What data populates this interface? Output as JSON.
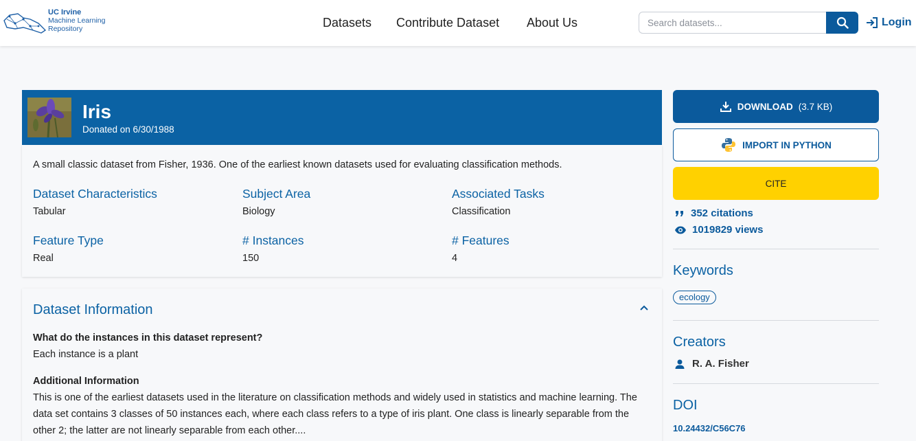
{
  "header": {
    "logo": {
      "line1": "UC Irvine",
      "line2": "Machine Learning",
      "line3": "Repository"
    },
    "nav": [
      {
        "label": "Datasets"
      },
      {
        "label": "Contribute Dataset"
      },
      {
        "label": "About Us"
      }
    ],
    "search": {
      "placeholder": "Search datasets...",
      "value": ""
    },
    "login_label": "Login"
  },
  "dataset": {
    "title": "Iris",
    "donated": "Donated on 6/30/1988",
    "description": "A small classic dataset from Fisher, 1936. One of the earliest known datasets used for evaluating classification methods.",
    "characteristics": [
      {
        "label": "Dataset Characteristics",
        "value": "Tabular"
      },
      {
        "label": "Subject Area",
        "value": "Biology"
      },
      {
        "label": "Associated Tasks",
        "value": "Classification"
      },
      {
        "label": "Feature Type",
        "value": "Real"
      },
      {
        "label": "# Instances",
        "value": "150"
      },
      {
        "label": "# Features",
        "value": "4"
      }
    ]
  },
  "info": {
    "title": "Dataset Information",
    "q1": "What do the instances in this dataset represent?",
    "a1": "Each instance is a plant",
    "q2": "Additional Information",
    "a2": "This is one of the earliest datasets used in the literature on classification methods and widely used in statistics and machine learning.  The data set contains 3 classes of 50 instances each, where each class refers to a type of iris plant.  One class is linearly separable from the other 2; the latter are not linearly separable from each other...."
  },
  "sidebar": {
    "download_label": "DOWNLOAD",
    "download_size": "(3.7 KB)",
    "python_label": "IMPORT IN PYTHON",
    "cite_label": "CITE",
    "citations": "352 citations",
    "views": "1019829 views",
    "keywords_title": "Keywords",
    "keywords": [
      "ecology"
    ],
    "creators_title": "Creators",
    "creators": [
      "R. A. Fisher"
    ],
    "doi_title": "DOI",
    "doi": "10.24432/C56C76"
  },
  "colors": {
    "brand": "#0b62a4",
    "button": "#0b5a9c",
    "cite": "#ffd100"
  }
}
